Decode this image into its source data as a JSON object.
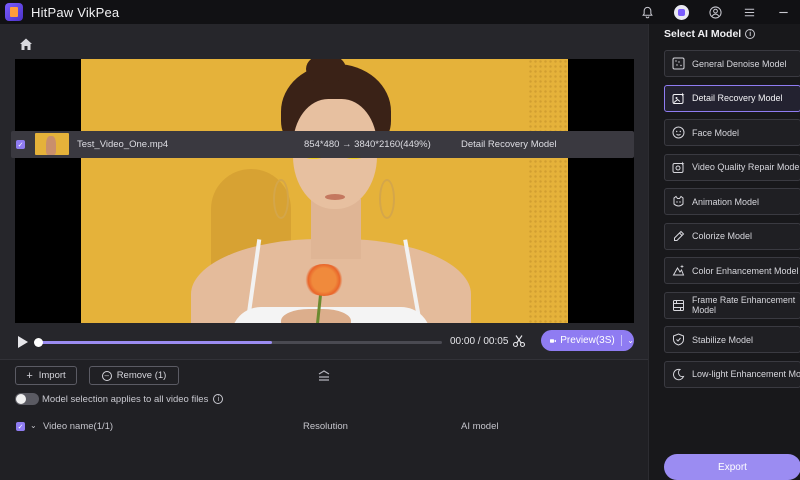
{
  "app": {
    "title": "HitPaw VikPea"
  },
  "titlebar": {
    "icons": [
      "bell-icon",
      "avatar-icon",
      "user-icon",
      "menu-icon",
      "minimize-icon"
    ]
  },
  "player": {
    "time": "00:00 / 00:05",
    "progress": 0.58,
    "preview_label": "Preview(3S)"
  },
  "file_panel": {
    "import_label": "Import",
    "remove_label": "Remove (1)",
    "toggle_label": "Model selection applies to all video files",
    "columns": {
      "name": "Video name(1/1)",
      "resolution": "Resolution",
      "model": "AI model"
    },
    "rows": [
      {
        "name": "Test_Video_One.mp4",
        "resolution": "854*480  →  3840*2160(449%)",
        "model": "Detail Recovery Model"
      }
    ]
  },
  "right_panel": {
    "title": "Select AI Model",
    "models": [
      {
        "label": "General Denoise Model",
        "icon": "denoise-icon",
        "active": false
      },
      {
        "label": "Detail Recovery Model",
        "icon": "detail-recovery-icon",
        "active": true
      },
      {
        "label": "Face Model",
        "icon": "face-icon",
        "active": false
      },
      {
        "label": "Video Quality Repair Model",
        "icon": "quality-repair-icon",
        "active": false
      },
      {
        "label": "Animation Model",
        "icon": "animation-icon",
        "active": false
      },
      {
        "label": "Colorize Model",
        "icon": "colorize-icon",
        "active": false
      },
      {
        "label": "Color Enhancement Model",
        "icon": "color-enhance-icon",
        "active": false
      },
      {
        "label": "Frame Rate Enhancement Model",
        "icon": "frame-rate-icon",
        "active": false
      },
      {
        "label": "Stabilize Model",
        "icon": "stabilize-icon",
        "active": false
      },
      {
        "label": "Low-light Enhancement Model",
        "icon": "low-light-icon",
        "active": false
      }
    ],
    "export_label": "Export"
  },
  "colors": {
    "accent": "#8f7cf2",
    "background": "#1b1b1f"
  }
}
